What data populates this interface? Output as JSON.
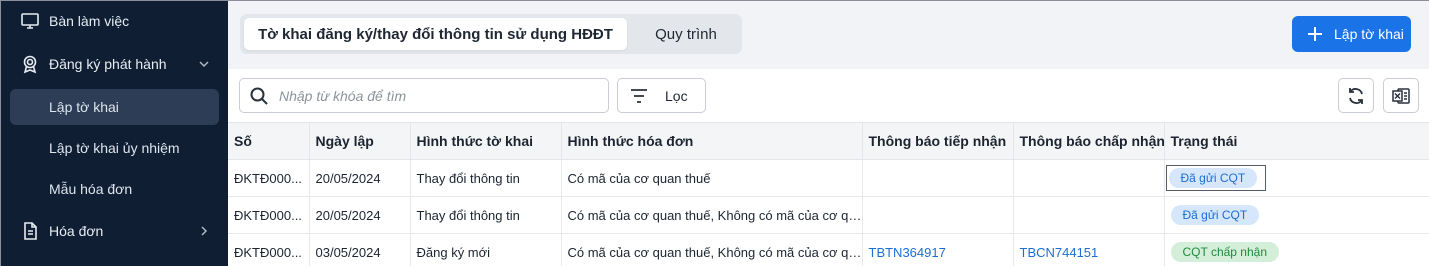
{
  "sidebar": {
    "items": [
      {
        "label": "Bàn làm việc"
      },
      {
        "label": "Đăng ký phát hành"
      },
      {
        "label": "Hóa đơn"
      }
    ],
    "sub_items": [
      {
        "label": "Lập tờ khai"
      },
      {
        "label": "Lập tờ khai ủy nhiệm"
      },
      {
        "label": "Mẫu hóa đơn"
      }
    ]
  },
  "tabs": [
    {
      "label": "Tờ khai đăng ký/thay đổi thông tin sử dụng HĐĐT"
    },
    {
      "label": "Quy trình"
    }
  ],
  "create_button": {
    "label": "Lập tờ khai"
  },
  "search": {
    "placeholder": "Nhập từ khóa để tìm"
  },
  "filter": {
    "label": "Lọc"
  },
  "colors": {
    "accent": "#1b73e8",
    "sidebar_bg": "#0f1e33",
    "link": "#1b6ed6"
  },
  "table": {
    "headers": [
      "Số",
      "Ngày lập",
      "Hình thức tờ khai",
      "Hình thức hóa đơn",
      "Thông báo tiếp nhận",
      "Thông báo chấp nhận",
      "Trạng thái"
    ],
    "rows": [
      [
        "ĐKTĐ000...",
        "20/05/2024",
        "Thay đổi thông tin",
        "Có mã của cơ quan thuế",
        "",
        "",
        "Đã gửi CQT"
      ],
      [
        "ĐKTĐ000...",
        "20/05/2024",
        "Thay đổi thông tin",
        "Có mã của cơ quan thuế, Không có mã của cơ quan...",
        "",
        "",
        "Đã gửi CQT"
      ],
      [
        "ĐKTĐ000...",
        "03/05/2024",
        "Đăng ký mới",
        "Có mã của cơ quan thuế, Không có mã của cơ quan...",
        "TBTN364917",
        "TBCN744151",
        "CQT chấp nhận"
      ]
    ]
  }
}
